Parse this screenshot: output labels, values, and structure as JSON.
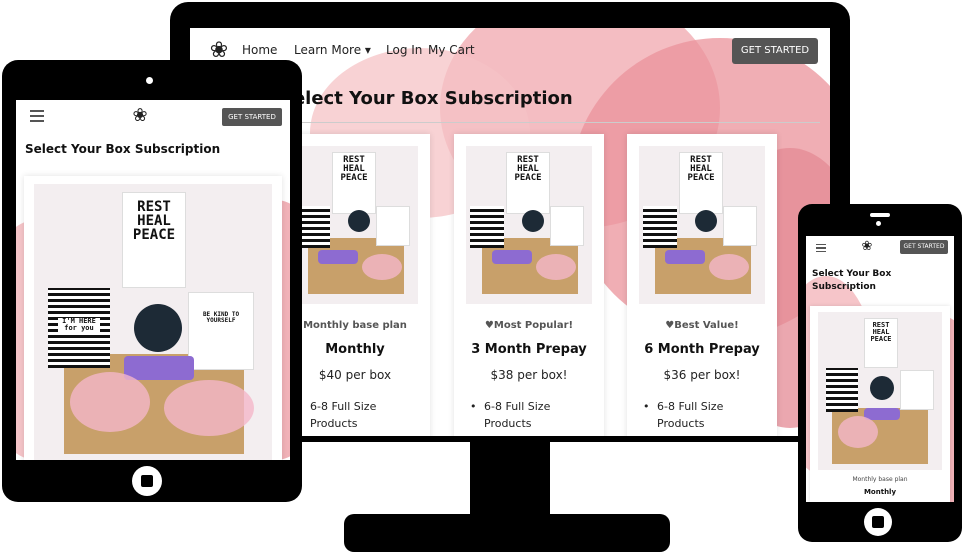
{
  "desktop": {
    "nav": {
      "links": [
        "Home",
        "Learn More ▾",
        "Log In",
        "My Cart"
      ],
      "cta": "GET STARTED"
    },
    "title": "Select Your Box Subscription",
    "cards": [
      {
        "tag": "Monthly base plan",
        "name": "Monthly",
        "price": "$40 per box",
        "feature": "6-8 Full Size Products"
      },
      {
        "tag": "♥Most Popular!",
        "name": "3 Month Prepay",
        "price": "$38 per box!",
        "feature": "6-8 Full Size Products"
      },
      {
        "tag": "♥Best Value!",
        "name": "6 Month Prepay",
        "price": "$36 per box!",
        "feature": "6-8 Full Size Products"
      }
    ]
  },
  "tablet": {
    "cta": "GET STARTED",
    "title": "Select Your Box Subscription"
  },
  "phone": {
    "cta": "GET STARTED",
    "title": "Select Your Box Subscription",
    "card": {
      "tag": "Monthly base plan",
      "name": "Monthly"
    }
  },
  "art": {
    "board_text": "REST HEAL PEACE",
    "stripe_text": "I'M HERE for you",
    "note_text": "BE KIND TO YOURSELF"
  },
  "icons": {
    "logo": "flower-pot-logo-icon",
    "menu": "hamburger-menu-icon"
  },
  "colors": {
    "accent_bg": "#e88a93",
    "button": "#555555",
    "device_frame": "#000000"
  }
}
